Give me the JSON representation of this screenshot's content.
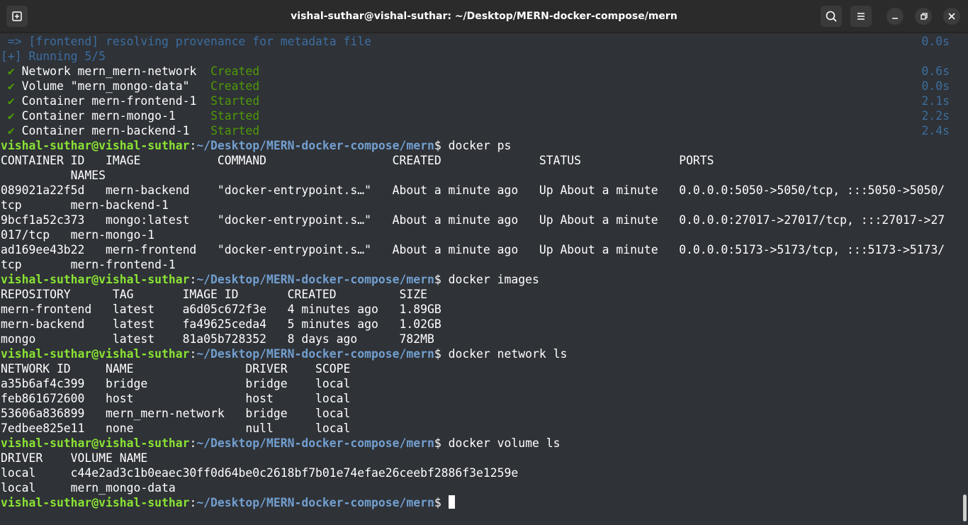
{
  "window": {
    "title": "vishal-suthar@vishal-suthar: ~/Desktop/MERN-docker-compose/mern"
  },
  "prompt": {
    "user_host": "vishal-suthar@vishal-suthar",
    "colon": ":",
    "path": "~/Desktop/MERN-docker-compose/mern",
    "dollar": "$ "
  },
  "build": {
    "resolving": " => [frontend] resolving provenance for metadata file",
    "resolving_time": "0.0s",
    "running": "[+] Running 5/5",
    "steps": [
      {
        "check": " ✔",
        "name": " Network mern_mern-network  ",
        "status": "Created",
        "time": "0.6s"
      },
      {
        "check": " ✔",
        "name": " Volume \"mern_mongo-data\"   ",
        "status": "Created",
        "time": "0.0s"
      },
      {
        "check": " ✔",
        "name": " Container mern-frontend-1  ",
        "status": "Started",
        "time": "2.1s"
      },
      {
        "check": " ✔",
        "name": " Container mern-mongo-1     ",
        "status": "Started",
        "time": "2.2s"
      },
      {
        "check": " ✔",
        "name": " Container mern-backend-1   ",
        "status": "Started",
        "time": "2.4s"
      }
    ]
  },
  "commands": {
    "ps": "docker ps",
    "images": "docker images",
    "network": "docker network ls",
    "volume": "docker volume ls"
  },
  "ps_output": [
    "CONTAINER ID   IMAGE           COMMAND                  CREATED              STATUS              PORTS",
    "          NAMES",
    "089021a22f5d   mern-backend    \"docker-entrypoint.s…\"   About a minute ago   Up About a minute   0.0.0.0:5050->5050/tcp, :::5050->5050/",
    "tcp       mern-backend-1",
    "9bcf1a52c373   mongo:latest    \"docker-entrypoint.s…\"   About a minute ago   Up About a minute   0.0.0.0:27017->27017/tcp, :::27017->27",
    "017/tcp   mern-mongo-1",
    "ad169ee43b22   mern-frontend   \"docker-entrypoint.s…\"   About a minute ago   Up About a minute   0.0.0.0:5173->5173/tcp, :::5173->5173/",
    "tcp       mern-frontend-1"
  ],
  "images_output": [
    "REPOSITORY      TAG       IMAGE ID       CREATED         SIZE",
    "mern-frontend   latest    a6d05c672f3e   4 minutes ago   1.89GB",
    "mern-backend    latest    fa49625ceda4   5 minutes ago   1.02GB",
    "mongo           latest    81a05b728352   8 days ago      782MB"
  ],
  "network_output": [
    "NETWORK ID     NAME                DRIVER    SCOPE",
    "a35b6af4c399   bridge              bridge    local",
    "feb861672600   host                host      local",
    "53606a836899   mern_mern-network   bridge    local",
    "7edbee825e11   none                null      local"
  ],
  "volume_output": [
    "DRIVER    VOLUME NAME",
    "local     c44e2ad3c1b0eaec30ff0d64be0c2618bf7b01e74efae26ceebf2886f3e1259e",
    "local     mern_mongo-data"
  ],
  "icons": {
    "new_tab": "new-tab-icon",
    "search": "search-icon",
    "menu": "hamburger-menu-icon",
    "minimize": "minimize-icon",
    "maximize": "maximize-icon",
    "close": "close-icon"
  },
  "colors": {
    "background": "#2f3237",
    "titlebar": "#2b2b2b",
    "prompt_user": "#8ae234",
    "prompt_path": "#729fcf",
    "status_green": "#4e9a06",
    "dim_blue": "#3d6e9e"
  }
}
